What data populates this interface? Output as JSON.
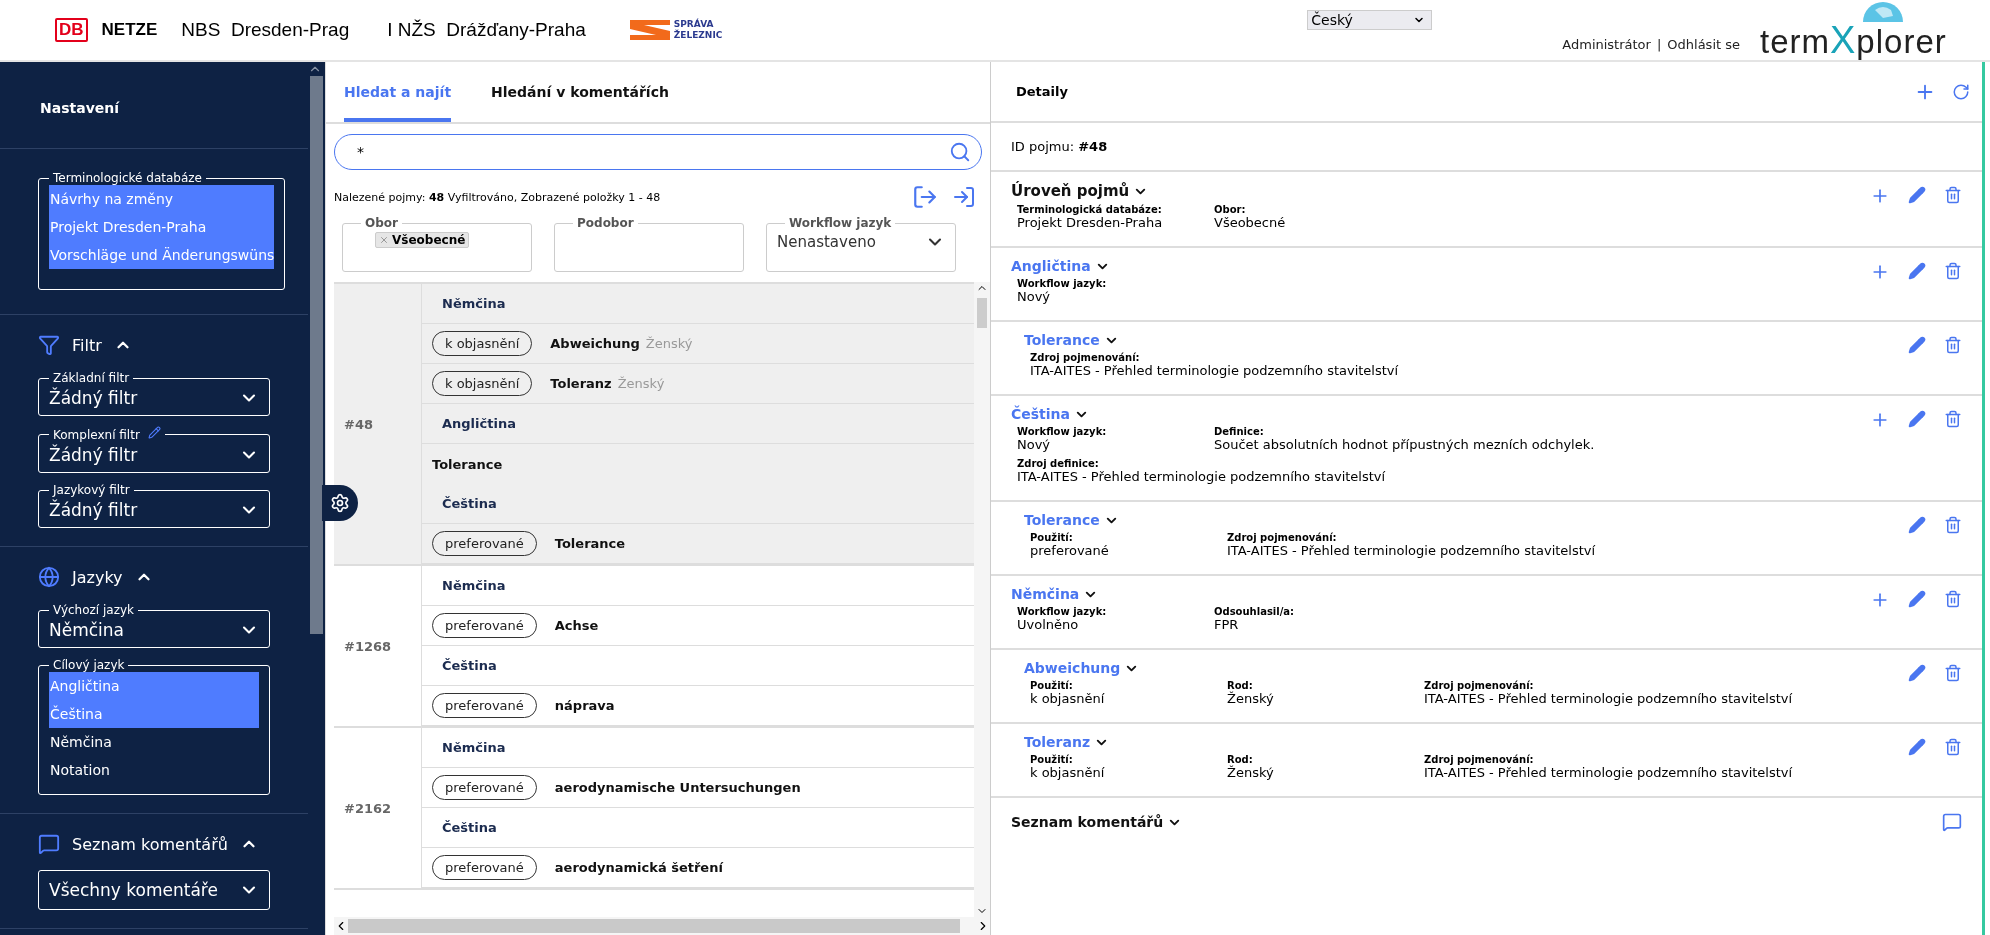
{
  "header": {
    "brand": {
      "mark": "DB",
      "name": "NETZE"
    },
    "project_de": "NBS  Dresden-Prag",
    "project_cz": "I NŽS  Drážďany-Praha",
    "partner_logo": [
      "SPRÁVA",
      "ŽELEZNIC"
    ],
    "language_select": "Český",
    "user": "Administrátor",
    "separator": "|",
    "logout": "Odhlásit se",
    "logo": {
      "before": "term",
      "mark": "X",
      "after": "plorer"
    }
  },
  "sidebar": {
    "title": "Nastavení",
    "databases": {
      "legend": "Terminologické databáze",
      "items": [
        {
          "label": "Návrhy na změny",
          "selected": true
        },
        {
          "label": "Projekt Dresden-Praha",
          "selected": true
        },
        {
          "label": "Vorschläge und Änderungswüns",
          "selected": true
        }
      ]
    },
    "filter": {
      "title": "Filtr",
      "expanded": true,
      "fields": [
        {
          "legend": "Základní filtr",
          "value": "Žádný filtr",
          "editable": false
        },
        {
          "legend": "Komplexní filtr",
          "value": "Žádný filtr",
          "editable": true
        },
        {
          "legend": "Jazykový filtr",
          "value": "Žádný filtr",
          "editable": false
        }
      ]
    },
    "languages": {
      "title": "Jazyky",
      "expanded": true,
      "source": {
        "legend": "Výchozí jazyk",
        "value": "Němčina"
      },
      "target": {
        "legend": "Cílový jazyk",
        "items": [
          {
            "label": "Angličtina",
            "selected": true
          },
          {
            "label": "Čeština",
            "selected": true
          },
          {
            "label": "Němčina",
            "selected": false
          },
          {
            "label": "Notation",
            "selected": false
          }
        ]
      }
    },
    "comments": {
      "title": "Seznam komentářů",
      "expanded": true,
      "value": "Všechny komentáře"
    }
  },
  "search_panel": {
    "tabs": [
      {
        "label": "Hledat a najít",
        "selected": true
      },
      {
        "label": "Hledání v komentářích",
        "selected": false
      }
    ],
    "search": {
      "value": "*"
    },
    "summary": "Nalezené pojmy: **48** Vyfiltrováno, Zobrazené položky 1 - 48",
    "filters": [
      {
        "kind": "tags",
        "legend": "Obor",
        "tags": [
          "Všeobecné"
        ]
      },
      {
        "kind": "tags",
        "legend": "Podobor"
      },
      {
        "kind": "select",
        "legend": "Workflow jazyk",
        "value": "Nenastaveno"
      }
    ],
    "results": [
      {
        "id": "#48",
        "selected": true,
        "rows": [
          {
            "kind": "language",
            "text": "Němčina"
          },
          {
            "kind": "term",
            "usage": "k objasnění",
            "term": "Abweichung",
            "gender": "Ženský"
          },
          {
            "kind": "term",
            "usage": "k objasnění",
            "term": "Toleranz",
            "gender": "Ženský"
          },
          {
            "kind": "language",
            "text": "Angličtina"
          },
          {
            "kind": "plain",
            "text": "Tolerance"
          },
          {
            "kind": "language",
            "text": "Čeština"
          },
          {
            "kind": "term",
            "usage": "preferované",
            "term": "Tolerance"
          }
        ]
      },
      {
        "id": "#1268",
        "selected": false,
        "rows": [
          {
            "kind": "language",
            "text": "Němčina"
          },
          {
            "kind": "term",
            "usage": "preferované",
            "term": "Achse"
          },
          {
            "kind": "language",
            "text": "Čeština"
          },
          {
            "kind": "term",
            "usage": "preferované",
            "term": "náprava"
          }
        ]
      },
      {
        "id": "#2162",
        "selected": false,
        "rows": [
          {
            "kind": "language",
            "text": "Němčina"
          },
          {
            "kind": "term",
            "usage": "preferované",
            "term": "aerodynamische Untersuchungen"
          },
          {
            "kind": "language",
            "text": "Čeština"
          },
          {
            "kind": "term",
            "usage": "preferované",
            "term": "aerodynamická šetření"
          }
        ]
      }
    ]
  },
  "details": {
    "title": "Detaily",
    "concept_id": "ID pojmu: **#48**",
    "sections": [
      {
        "kind": "concept",
        "title": "Úroveň pojmů",
        "rows": [
          [
            {
              "label": "Terminologická databáze:",
              "value": "Projekt Dresden-Praha"
            },
            {
              "label": "Obor:",
              "value": "Všeobecné"
            }
          ]
        ]
      },
      {
        "kind": "language",
        "title": "Angličtina",
        "rows": [
          [
            {
              "label": "Workflow jazyk:",
              "value": "Nový"
            }
          ]
        ]
      },
      {
        "kind": "term",
        "title": "Tolerance",
        "rows": [
          [
            {
              "label": "Zdroj pojmenování:",
              "value": "ITA-AITES - Přehled terminologie podzemního stavitelství"
            }
          ]
        ]
      },
      {
        "kind": "language",
        "title": "Čeština",
        "rows": [
          [
            {
              "label": "Workflow jazyk:",
              "value": "Nový"
            },
            {
              "label": "Definice:",
              "value": "Součet absolutních hodnot přípustných mezních odchylek."
            }
          ],
          [
            {
              "label": "Zdroj definice:",
              "value": "ITA-AITES - Přehled terminologie podzemního stavitelství"
            }
          ]
        ]
      },
      {
        "kind": "term",
        "title": "Tolerance",
        "rows": [
          [
            {
              "label": "Použití:",
              "value": "preferované"
            },
            {
              "label": "Zdroj pojmenování:",
              "value": "ITA-AITES - Přehled terminologie podzemního stavitelství"
            }
          ]
        ]
      },
      {
        "kind": "language",
        "title": "Němčina",
        "rows": [
          [
            {
              "label": "Workflow jazyk:",
              "value": "Uvolněno"
            },
            {
              "label": "Odsouhlasil/a:",
              "value": "FPR"
            }
          ]
        ]
      },
      {
        "kind": "term",
        "title": "Abweichung",
        "rows": [
          [
            {
              "label": "Použití:",
              "value": "k objasnění"
            },
            {
              "label": "Rod:",
              "value": "Ženský"
            },
            {
              "label": "Zdroj pojmenování:",
              "value": "ITA-AITES - Přehled terminologie podzemního stavitelství"
            }
          ]
        ]
      },
      {
        "kind": "term",
        "title": "Toleranz",
        "rows": [
          [
            {
              "label": "Použití:",
              "value": "k objasnění"
            },
            {
              "label": "Rod:",
              "value": "Ženský"
            },
            {
              "label": "Zdroj pojmenování:",
              "value": "ITA-AITES - Přehled terminologie podzemního stavitelství"
            }
          ]
        ]
      }
    ],
    "comments_title": "Seznam komentářů"
  }
}
